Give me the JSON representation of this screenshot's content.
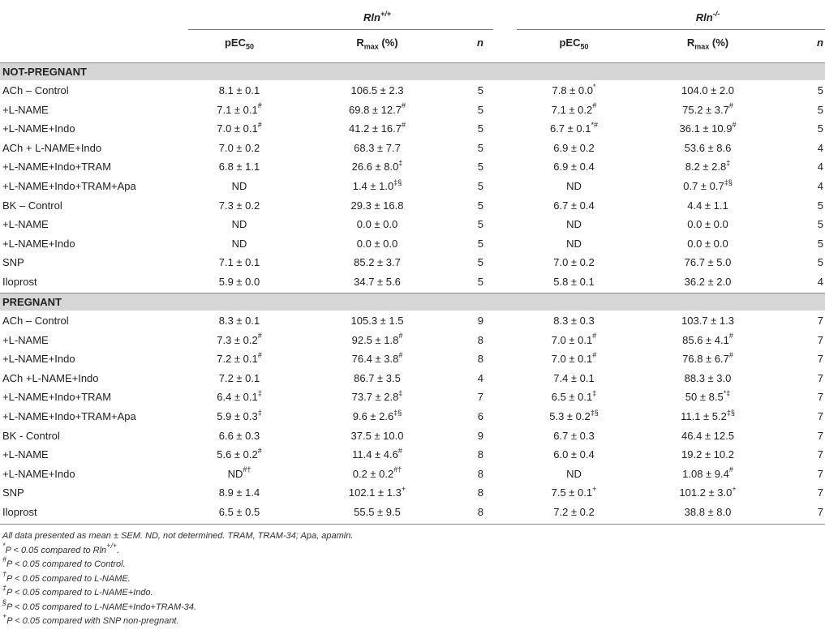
{
  "header": {
    "group1": {
      "name": "Rln",
      "sup": "+/+"
    },
    "group2": {
      "name": "Rln",
      "sup": "-/-"
    },
    "col_pec": {
      "base": "pEC",
      "sub": "50"
    },
    "col_rmax": {
      "base": "R",
      "sub": "max",
      "rest": " (%)"
    },
    "col_n": "n"
  },
  "sections": [
    {
      "title": "NOT-PREGNANT",
      "rows": [
        {
          "label": "ACh – Control",
          "c": [
            [
              "8.1 ± 0.1",
              ""
            ],
            [
              "106.5 ± 2.3",
              ""
            ],
            [
              "5",
              ""
            ],
            [
              "7.8 ± 0.0",
              "*"
            ],
            [
              "104.0 ± 2.0",
              ""
            ],
            [
              "5",
              ""
            ]
          ]
        },
        {
          "label": "+L-NAME",
          "c": [
            [
              "7.1 ± 0.1",
              "#"
            ],
            [
              "69.8 ± 12.7",
              "#"
            ],
            [
              "5",
              ""
            ],
            [
              "7.1 ± 0.2",
              "#"
            ],
            [
              "75.2 ± 3.7",
              "#"
            ],
            [
              "5",
              ""
            ]
          ]
        },
        {
          "label": "+L-NAME+Indo",
          "c": [
            [
              "7.0 ± 0.1",
              "#"
            ],
            [
              "41.2 ± 16.7",
              "#"
            ],
            [
              "5",
              ""
            ],
            [
              "6.7 ± 0.1",
              "*#"
            ],
            [
              "36.1 ± 10.9",
              "#"
            ],
            [
              "5",
              ""
            ]
          ]
        },
        {
          "label": "ACh + L-NAME+Indo",
          "c": [
            [
              "7.0 ± 0.2",
              ""
            ],
            [
              "68.3 ± 7.7",
              ""
            ],
            [
              "5",
              ""
            ],
            [
              "6.9 ± 0.2",
              ""
            ],
            [
              "53.6 ± 8.6",
              ""
            ],
            [
              "4",
              ""
            ]
          ]
        },
        {
          "label": "+L-NAME+Indo+TRAM",
          "c": [
            [
              "6.8 ± 1.1",
              ""
            ],
            [
              "26.6 ± 8.0",
              "‡"
            ],
            [
              "5",
              ""
            ],
            [
              "6.9 ± 0.4",
              ""
            ],
            [
              "8.2 ± 2.8",
              "‡"
            ],
            [
              "4",
              ""
            ]
          ]
        },
        {
          "label": "+L-NAME+Indo+TRAM+Apa",
          "c": [
            [
              "ND",
              ""
            ],
            [
              "1.4 ± 1.0",
              "‡§"
            ],
            [
              "5",
              ""
            ],
            [
              "ND",
              ""
            ],
            [
              "0.7 ± 0.7",
              "‡§"
            ],
            [
              "4",
              ""
            ]
          ]
        },
        {
          "label": "BK – Control",
          "c": [
            [
              "7.3 ± 0.2",
              ""
            ],
            [
              "29.3 ± 16.8",
              ""
            ],
            [
              "5",
              ""
            ],
            [
              "6.7 ± 0.4",
              ""
            ],
            [
              "4.4 ± 1.1",
              ""
            ],
            [
              "5",
              ""
            ]
          ]
        },
        {
          "label": "+L-NAME",
          "c": [
            [
              "ND",
              ""
            ],
            [
              "0.0 ± 0.0",
              ""
            ],
            [
              "5",
              ""
            ],
            [
              "ND",
              ""
            ],
            [
              "0.0 ± 0.0",
              ""
            ],
            [
              "5",
              ""
            ]
          ]
        },
        {
          "label": "+L-NAME+Indo",
          "c": [
            [
              "ND",
              ""
            ],
            [
              "0.0 ± 0.0",
              ""
            ],
            [
              "5",
              ""
            ],
            [
              "ND",
              ""
            ],
            [
              "0.0 ± 0.0",
              ""
            ],
            [
              "5",
              ""
            ]
          ]
        },
        {
          "label": "SNP",
          "c": [
            [
              "7.1 ± 0.1",
              ""
            ],
            [
              "85.2 ± 3.7",
              ""
            ],
            [
              "5",
              ""
            ],
            [
              "7.0 ± 0.2",
              ""
            ],
            [
              "76.7 ± 5.0",
              ""
            ],
            [
              "5",
              ""
            ]
          ]
        },
        {
          "label": "Iloprost",
          "c": [
            [
              "5.9 ± 0.0",
              ""
            ],
            [
              "34.7 ± 5.6",
              ""
            ],
            [
              "5",
              ""
            ],
            [
              "5.8 ± 0.1",
              ""
            ],
            [
              "36.2 ± 2.0",
              ""
            ],
            [
              "4",
              ""
            ]
          ]
        }
      ]
    },
    {
      "title": "PREGNANT",
      "rows": [
        {
          "label": "ACh – Control",
          "c": [
            [
              "8.3 ± 0.1",
              ""
            ],
            [
              "105.3 ± 1.5",
              ""
            ],
            [
              "9",
              ""
            ],
            [
              "8.3 ± 0.3",
              ""
            ],
            [
              "103.7 ± 1.3",
              ""
            ],
            [
              "7",
              ""
            ]
          ]
        },
        {
          "label": "+L-NAME",
          "c": [
            [
              "7.3 ± 0.2",
              "#"
            ],
            [
              "92.5 ± 1.8",
              "#"
            ],
            [
              "8",
              ""
            ],
            [
              "7.0 ± 0.1",
              "#"
            ],
            [
              "85.6 ± 4.1",
              "#"
            ],
            [
              "7",
              ""
            ]
          ]
        },
        {
          "label": "+L-NAME+Indo",
          "c": [
            [
              "7.2 ± 0.1",
              "#"
            ],
            [
              "76.4 ± 3.8",
              "#"
            ],
            [
              "8",
              ""
            ],
            [
              "7.0 ± 0.1",
              "#"
            ],
            [
              "76.8 ± 6.7",
              "#"
            ],
            [
              "7",
              ""
            ]
          ]
        },
        {
          "label": "ACh +L-NAME+Indo",
          "c": [
            [
              "7.2 ± 0.1",
              ""
            ],
            [
              "86.7 ± 3.5",
              ""
            ],
            [
              "4",
              ""
            ],
            [
              "7.4 ± 0.1",
              ""
            ],
            [
              "88.3 ± 3.0",
              ""
            ],
            [
              "7",
              ""
            ]
          ]
        },
        {
          "label": "+L-NAME+Indo+TRAM",
          "c": [
            [
              "6.4 ± 0.1",
              "‡"
            ],
            [
              "73.7 ± 2.8",
              "‡"
            ],
            [
              "7",
              ""
            ],
            [
              "6.5 ± 0.1",
              "‡"
            ],
            [
              "50 ± 8.5",
              "*‡"
            ],
            [
              "7",
              ""
            ]
          ]
        },
        {
          "label": "+L-NAME+Indo+TRAM+Apa",
          "c": [
            [
              "5.9 ± 0.3",
              "‡"
            ],
            [
              "9.6 ± 2.6",
              "‡§"
            ],
            [
              "6",
              ""
            ],
            [
              "5.3 ± 0.2",
              "‡§"
            ],
            [
              "11.1 ± 5.2",
              "‡§"
            ],
            [
              "7",
              ""
            ]
          ]
        },
        {
          "label": "BK - Control",
          "c": [
            [
              "6.6 ± 0.3",
              ""
            ],
            [
              "37.5 ± 10.0",
              ""
            ],
            [
              "9",
              ""
            ],
            [
              "6.7 ± 0.3",
              ""
            ],
            [
              "46.4 ± 12.5",
              ""
            ],
            [
              "7",
              ""
            ]
          ]
        },
        {
          "label": "+L-NAME",
          "c": [
            [
              "5.6 ± 0.2",
              "#"
            ],
            [
              "11.4 ± 4.6",
              "#"
            ],
            [
              "8",
              ""
            ],
            [
              "6.0 ± 0.4",
              ""
            ],
            [
              "19.2 ± 10.2",
              ""
            ],
            [
              "7",
              ""
            ]
          ]
        },
        {
          "label": "+L-NAME+Indo",
          "c": [
            [
              "ND",
              "#†"
            ],
            [
              "0.2 ± 0.2",
              "#†"
            ],
            [
              "8",
              ""
            ],
            [
              "ND",
              ""
            ],
            [
              "1.08 ± 9.4",
              "#"
            ],
            [
              "7",
              ""
            ]
          ]
        },
        {
          "label": "SNP",
          "c": [
            [
              "8.9 ± 1.4",
              ""
            ],
            [
              "102.1 ± 1.3",
              "+"
            ],
            [
              "8",
              ""
            ],
            [
              "7.5 ± 0.1",
              "+"
            ],
            [
              "101.2 ± 3.0",
              "+"
            ],
            [
              "7",
              ""
            ]
          ]
        },
        {
          "label": "Iloprost",
          "c": [
            [
              "6.5 ± 0.5",
              ""
            ],
            [
              "55.5 ± 9.5",
              ""
            ],
            [
              "8",
              ""
            ],
            [
              "7.2 ± 0.2",
              ""
            ],
            [
              "38.8 ± 8.0",
              ""
            ],
            [
              "7",
              ""
            ]
          ]
        }
      ]
    }
  ],
  "footnotes": [
    {
      "sym": "",
      "text": "All data presented as mean ± SEM. ND, not determined. TRAM, TRAM-34; Apa, apamin."
    },
    {
      "sym": "*",
      "text": "P < 0.05 compared to Rln",
      "sup2": "+/+",
      "tail": "."
    },
    {
      "sym": "#",
      "text": "P < 0.05 compared to Control."
    },
    {
      "sym": "†",
      "text": "P < 0.05 compared to L-NAME."
    },
    {
      "sym": "‡",
      "text": "P < 0.05 compared to L-NAME+Indo."
    },
    {
      "sym": "§",
      "text": "P < 0.05 compared to L-NAME+Indo+TRAM-34."
    },
    {
      "sym": "+",
      "text": "P < 0.05 compared with SNP non-pregnant."
    }
  ]
}
